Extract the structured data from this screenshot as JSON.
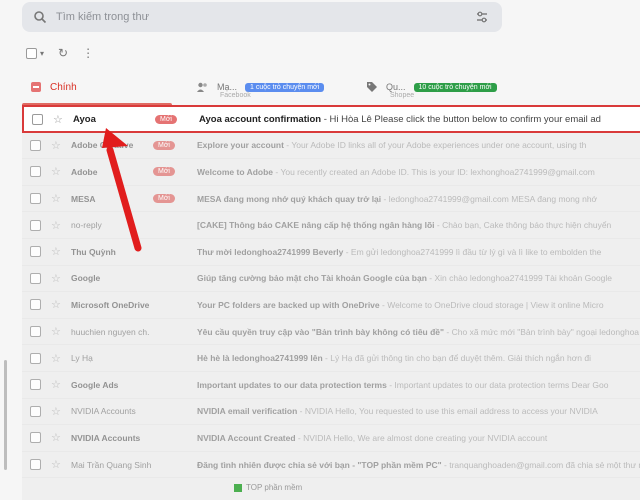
{
  "search": {
    "placeholder": "Tìm kiếm trong thư"
  },
  "tabs": {
    "primary": {
      "label": "Chính"
    },
    "social": {
      "label": "Mạ...",
      "sub": "Facebook",
      "badge": "1 cuộc trò chuyện mới",
      "badge_color": "#5b8def"
    },
    "promotions": {
      "label": "Qu...",
      "sub": "Shopee",
      "badge": "10 cuộc trò chuyện mới",
      "badge_color": "#2e9e48"
    }
  },
  "emails": [
    {
      "sender": "Ayoa",
      "badge": "Mới",
      "subject": "Ayoa account confirmation",
      "snippet": " - Hi Hòa Lê Please click the button below to confirm your email ad",
      "bold": true
    },
    {
      "sender": "Adobe Creative",
      "badge": "Mới",
      "subject": "Explore your account",
      "snippet": " - Your Adobe ID links all of your Adobe experiences under one account, using th",
      "bold": true
    },
    {
      "sender": "Adobe",
      "badge": "Mới",
      "subject": "Welcome to Adobe",
      "snippet": " - You recently created an Adobe ID. This is your ID: lexhonghoa2741999@gmail.com",
      "bold": true
    },
    {
      "sender": "MESA",
      "badge": "Mới",
      "subject": "MESA đang mong nhớ quý khách quay trở lại",
      "snippet": " - ledonghoa2741999@gmail.com MESA đang mong nhớ",
      "bold": true
    },
    {
      "sender": "no-reply",
      "badge": "",
      "subject": "[CAKE] Thông báo CAKE nâng cấp hệ thống ngân hàng lõi",
      "snippet": " - Chào bạn, Cake thông báo thực hiện chuyển",
      "bold": false
    },
    {
      "sender": "Thu Quỳnh",
      "badge": "",
      "subject": "Thư mời ledonghoa2741999 Beverly",
      "snippet": " - Em gửi ledonghoa2741999 lì đầu từ lý gì và lì like to embolden the",
      "bold": true
    },
    {
      "sender": "Google",
      "badge": "",
      "subject": "Giúp tăng cường bảo mật cho Tài khoản Google của bạn",
      "snippet": " - Xin chào ledonghoa2741999 Tài khoản Google",
      "bold": true
    },
    {
      "sender": "Microsoft OneDrive",
      "badge": "",
      "subject": "Your PC folders are backed up with OneDrive",
      "snippet": " - Welcome to OneDrive cloud storage | View it online Micro",
      "bold": true
    },
    {
      "sender": "huuchien nguyen ch.",
      "badge": "",
      "subject": "Yêu cầu quyền truy cập vào \"Bản trình bày không có tiêu đề\"",
      "snippet": " - Cho xã mức mới \"Bản trình bày\" ngoại ledonghoa",
      "bold": false
    },
    {
      "sender": "Ly Hạ",
      "badge": "",
      "subject": "Hè hè là ledonghoa2741999 lên",
      "snippet": " - Lý Hạ đã gửi thông tin cho bạn để duyệt thêm. Giải thích ngắn hơn đi",
      "bold": false
    },
    {
      "sender": "Google Ads",
      "badge": "",
      "subject": "Important updates to our data protection terms",
      "snippet": " - Important updates to our data protection terms Dear Goo",
      "bold": true
    },
    {
      "sender": "NVIDIA Accounts",
      "badge": "",
      "subject": "NVIDIA email verification",
      "snippet": " - NVIDIA Hello, You requested to use this email address to access your NVIDIA",
      "bold": false
    },
    {
      "sender": "NVIDIA Accounts",
      "badge": "",
      "subject": "NVIDIA Account Created",
      "snippet": " - NVIDIA Hello, We are almost done creating your NVIDIA account",
      "bold": true
    },
    {
      "sender": "Mai Trần Quang Sinh",
      "badge": "",
      "subject": "Đăng tình nhiên được chia sẻ với bạn - \"TOP phần mềm PC\"",
      "snippet": " - tranquanghoaden@gmail.com đã chia sẻ một thư mục",
      "bold": false
    }
  ],
  "footer": {
    "text": "TOP phần mềm"
  },
  "colors": {
    "highlight_border": "#d93a3a",
    "arrow": "#e11d1d",
    "badge": "#e57373"
  }
}
